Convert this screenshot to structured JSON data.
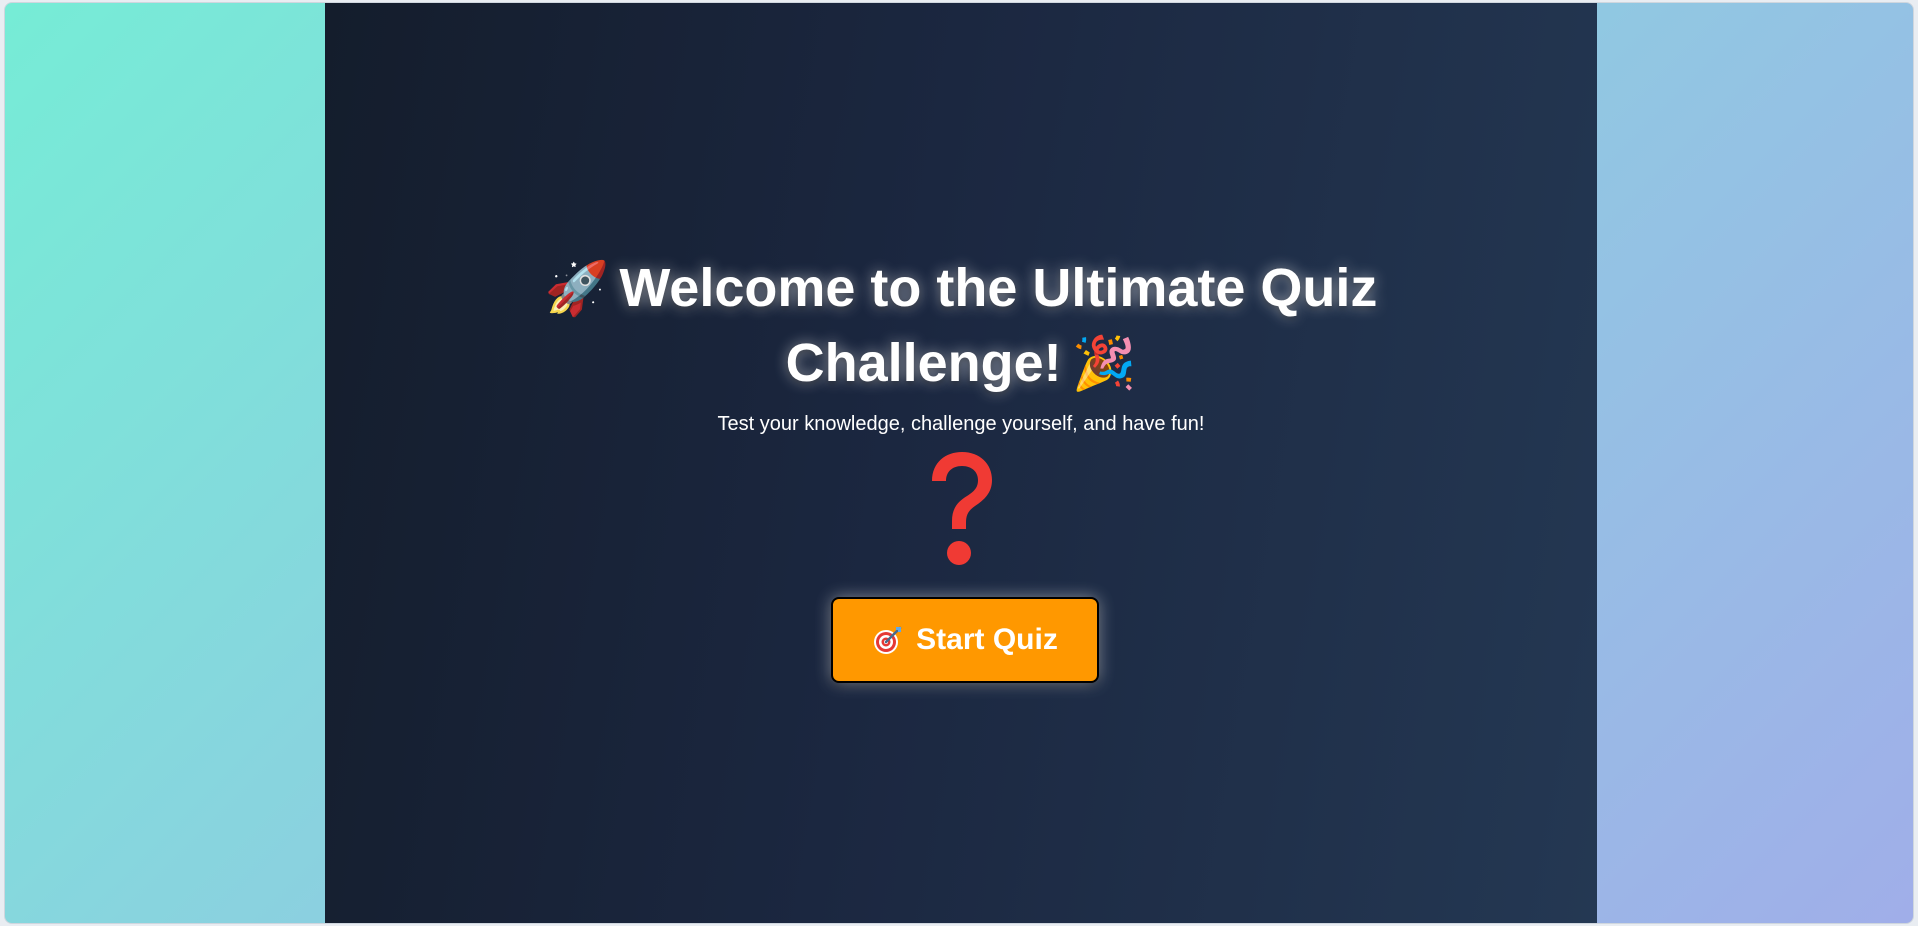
{
  "hero": {
    "title_emoji_left": "🚀",
    "title_text": "Welcome to the Ultimate Quiz Challenge!",
    "title_emoji_right": "🎉",
    "subtitle": "Test your knowledge, challenge yourself, and have fun!",
    "question_icon": "question-mark-icon"
  },
  "start_button": {
    "icon": "target-icon",
    "label": "Start Quiz"
  },
  "colors": {
    "side_gradient_start": "#76ecd6",
    "side_gradient_end": "#a0aee9",
    "panel_dark": "#141d2c",
    "panel_light": "#243853",
    "button_orange": "#ff9800",
    "question_red": "#f03a34",
    "text_white": "#ffffff"
  }
}
